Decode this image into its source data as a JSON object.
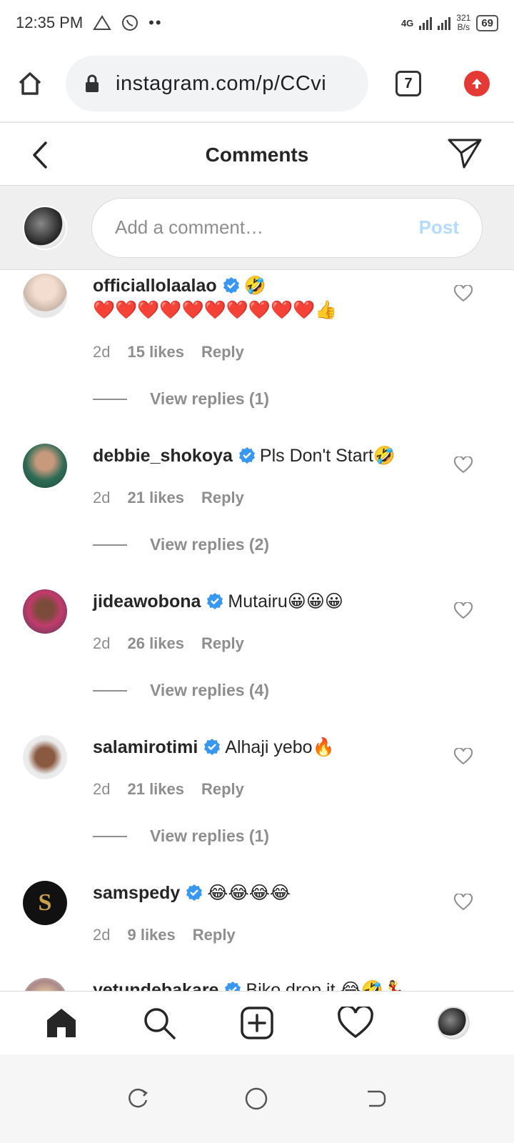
{
  "status_bar": {
    "time": "12:35 PM",
    "network": "4G",
    "speed_value": "321",
    "speed_unit": "B/s",
    "battery": "69"
  },
  "browser": {
    "url": "instagram.com/p/CCvi",
    "tab_count": "7"
  },
  "header": {
    "title": "Comments"
  },
  "add_comment": {
    "placeholder": "Add a comment…",
    "post_label": "Post"
  },
  "comments": [
    {
      "username": "officiallolaalao",
      "text": "🤣",
      "text_line2": "❤️❤️❤️❤️❤️❤️❤️❤️❤️❤️👍",
      "time": "2d",
      "likes": "15 likes",
      "reply": "Reply",
      "view_replies": "View replies (1)"
    },
    {
      "username": "debbie_shokoya",
      "text": "Pls Don't Start🤣",
      "time": "2d",
      "likes": "21 likes",
      "reply": "Reply",
      "view_replies": "View replies (2)"
    },
    {
      "username": "jideawobona",
      "text": "Mutairu😀😀😀",
      "time": "2d",
      "likes": "26 likes",
      "reply": "Reply",
      "view_replies": "View replies (4)"
    },
    {
      "username": "salamirotimi",
      "text": "Alhaji yebo🔥",
      "time": "2d",
      "likes": "21 likes",
      "reply": "Reply",
      "view_replies": "View replies (1)"
    },
    {
      "username": "samspedy",
      "text": "😂😂😂😂",
      "time": "2d",
      "likes": "9 likes",
      "reply": "Reply"
    },
    {
      "username": "yetundebakare",
      "text": "Biko drop it 😂🤣💃"
    }
  ],
  "colors": {
    "verified": "#3897f0",
    "post_disabled": "#b3dbff",
    "secondary_text": "#8e8e8e"
  },
  "icons": {
    "nav": [
      "home-icon",
      "search-icon",
      "new-post-icon",
      "activity-heart-icon",
      "profile-avatar"
    ],
    "system": [
      "recent-apps-icon",
      "home-circle-icon",
      "back-icon"
    ]
  }
}
